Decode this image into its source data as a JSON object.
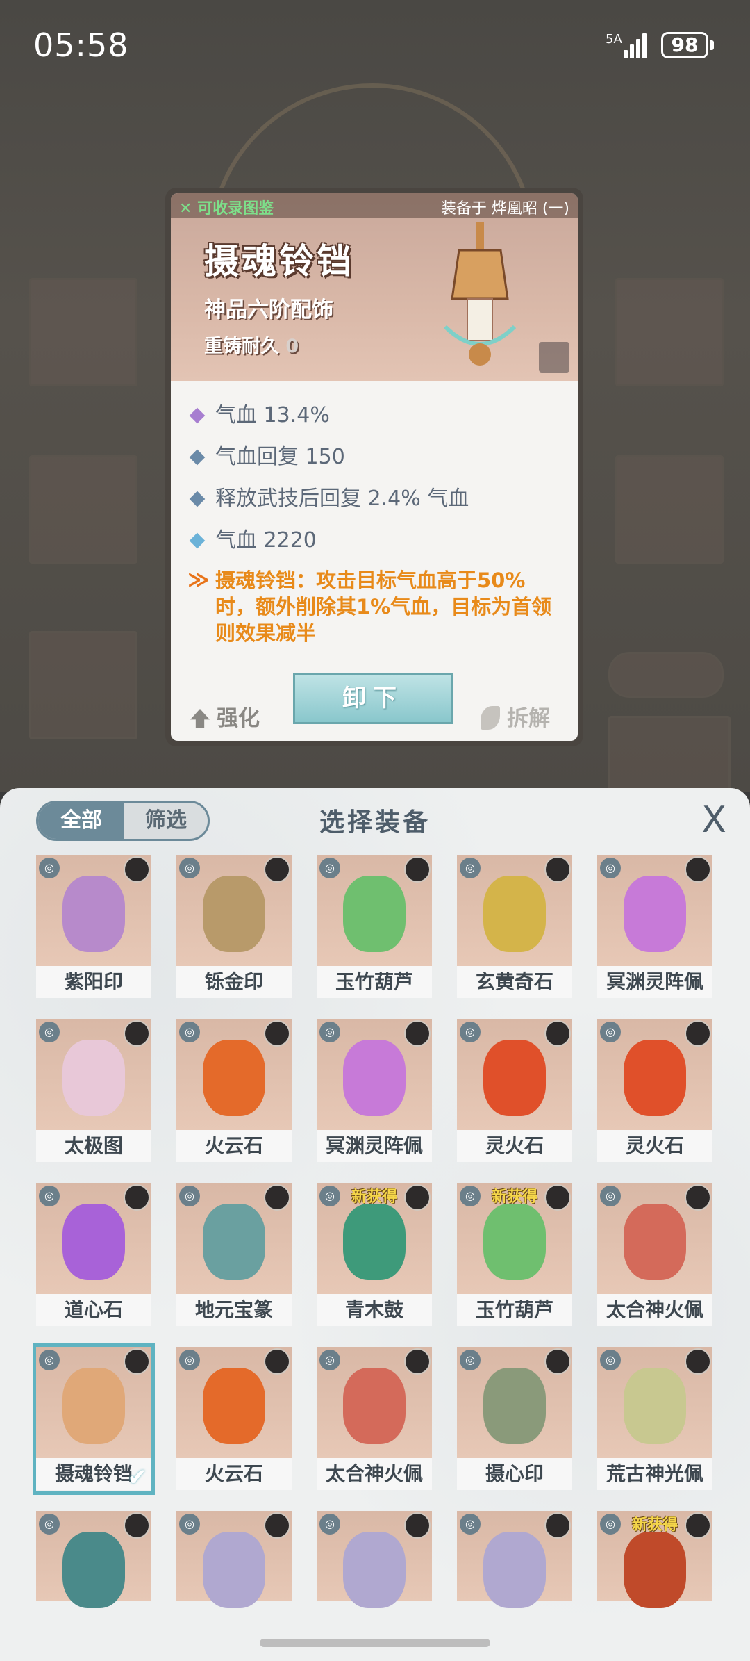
{
  "status": {
    "time": "05:58",
    "network": "5A",
    "battery": "98"
  },
  "detail": {
    "collect_label": "可收录图鉴",
    "equipped_label": "装备于 烨凰昭 (一)",
    "name": "摄魂铃铛",
    "grade": "神品六阶配饰",
    "durability_label": "重铸耐久",
    "durability_value": "0",
    "stats": [
      {
        "text": "气血 13.4%",
        "color": "#a77ed0"
      },
      {
        "text": "气血回复 150",
        "color": "#6a8aa8"
      },
      {
        "text": "释放武技后回复 2.4% 气血",
        "color": "#6a8aa8"
      },
      {
        "text": "气血 2220",
        "color": "#6bb2d8"
      }
    ],
    "special": "摄魂铃铛：攻击目标气血高于50%时，额外削除其1%气血，目标为首领则效果减半",
    "enhance_label": "强化",
    "unload_label": "卸下",
    "disassemble_label": "拆解"
  },
  "sheet": {
    "tab_all": "全部",
    "tab_filter": "筛选",
    "title": "选择装备",
    "close": "X",
    "new_badge": "新获得",
    "items": [
      {
        "name": "紫阳印",
        "color": "#b78acb",
        "new": false,
        "selected": false
      },
      {
        "name": "铄金印",
        "color": "#b89a6a",
        "new": false,
        "selected": false
      },
      {
        "name": "玉竹葫芦",
        "color": "#6fbf6f",
        "new": false,
        "selected": false
      },
      {
        "name": "玄黄奇石",
        "color": "#d4b44a",
        "new": false,
        "selected": false
      },
      {
        "name": "冥渊灵阵佩",
        "color": "#c77ad8",
        "new": false,
        "selected": false
      },
      {
        "name": "太极图",
        "color": "#e8c8d8",
        "new": false,
        "selected": false
      },
      {
        "name": "火云石",
        "color": "#e46a2a",
        "new": false,
        "selected": false
      },
      {
        "name": "冥渊灵阵佩",
        "color": "#c77ad8",
        "new": false,
        "selected": false
      },
      {
        "name": "灵火石",
        "color": "#e0502a",
        "new": false,
        "selected": false
      },
      {
        "name": "灵火石",
        "color": "#e0502a",
        "new": false,
        "selected": false
      },
      {
        "name": "道心石",
        "color": "#a862d8",
        "new": false,
        "selected": false
      },
      {
        "name": "地元宝篆",
        "color": "#6aa0a0",
        "new": false,
        "selected": false
      },
      {
        "name": "青木鼓",
        "color": "#3e9a7a",
        "new": true,
        "selected": false
      },
      {
        "name": "玉竹葫芦",
        "color": "#6fbf6f",
        "new": true,
        "selected": false
      },
      {
        "name": "太合神火佩",
        "color": "#d46a5a",
        "new": false,
        "selected": false
      },
      {
        "name": "摄魂铃铛",
        "color": "#e0a878",
        "new": false,
        "selected": true
      },
      {
        "name": "火云石",
        "color": "#e46a2a",
        "new": false,
        "selected": false
      },
      {
        "name": "太合神火佩",
        "color": "#d46a5a",
        "new": false,
        "selected": false
      },
      {
        "name": "摄心印",
        "color": "#8a9a7a",
        "new": false,
        "selected": false
      },
      {
        "name": "荒古神光佩",
        "color": "#c8c890",
        "new": false,
        "selected": false
      },
      {
        "name": "",
        "color": "#4a8a8a",
        "new": false,
        "selected": false
      },
      {
        "name": "",
        "color": "#b0a8d0",
        "new": false,
        "selected": false
      },
      {
        "name": "",
        "color": "#b0a8d0",
        "new": false,
        "selected": false
      },
      {
        "name": "",
        "color": "#b0a8d0",
        "new": false,
        "selected": false
      },
      {
        "name": "",
        "color": "#c04a2a",
        "new": true,
        "selected": false
      }
    ]
  }
}
